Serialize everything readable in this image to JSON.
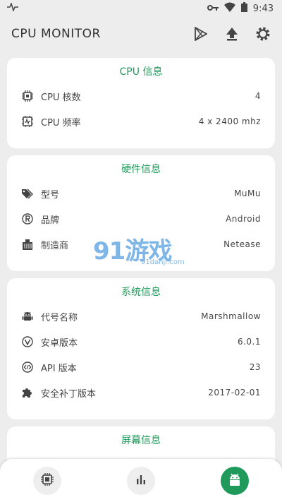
{
  "status_bar": {
    "time": "9:43",
    "icons": [
      "activity-icon",
      "key-icon",
      "wifi-icon",
      "battery-icon"
    ]
  },
  "app_bar": {
    "title": "CPU MONITOR",
    "actions": [
      "play-store-icon",
      "upload-icon",
      "settings-icon"
    ]
  },
  "cards": {
    "cpu": {
      "title": "CPU 信息",
      "rows": [
        {
          "icon": "cpu-chip-icon",
          "label": "CPU 核数",
          "value": "4"
        },
        {
          "icon": "cpu-frequency-icon",
          "label": "CPU 频率",
          "value": "4 x 2400 mhz"
        }
      ]
    },
    "hardware": {
      "title": "硬件信息",
      "rows": [
        {
          "icon": "tag-icon",
          "label": "型号",
          "value": "MuMu"
        },
        {
          "icon": "registered-icon",
          "label": "品牌",
          "value": "Android"
        },
        {
          "icon": "building-icon",
          "label": "制造商",
          "value": "Netease"
        }
      ]
    },
    "system": {
      "title": "系统信息",
      "rows": [
        {
          "icon": "android-icon",
          "label": "代号名称",
          "value": "Marshmallow"
        },
        {
          "icon": "version-icon",
          "label": "安卓版本",
          "value": "6.0.1"
        },
        {
          "icon": "api-code-icon",
          "label": "API 版本",
          "value": "23"
        },
        {
          "icon": "puzzle-icon",
          "label": "安全补丁版本",
          "value": "2017-02-01"
        }
      ]
    },
    "screen": {
      "title": "屏幕信息"
    }
  },
  "watermark": {
    "logo": "91游戏",
    "url": "91danji.com"
  },
  "bottom_nav": {
    "items": [
      {
        "icon": "cpu-tab-icon",
        "active": false
      },
      {
        "icon": "bar-chart-icon",
        "active": false
      },
      {
        "icon": "android-tab-icon",
        "active": true
      }
    ]
  },
  "colors": {
    "accent": "#1f9a5a",
    "background": "#ededed",
    "card": "#ffffff",
    "watermark": "#7fb6e8"
  }
}
